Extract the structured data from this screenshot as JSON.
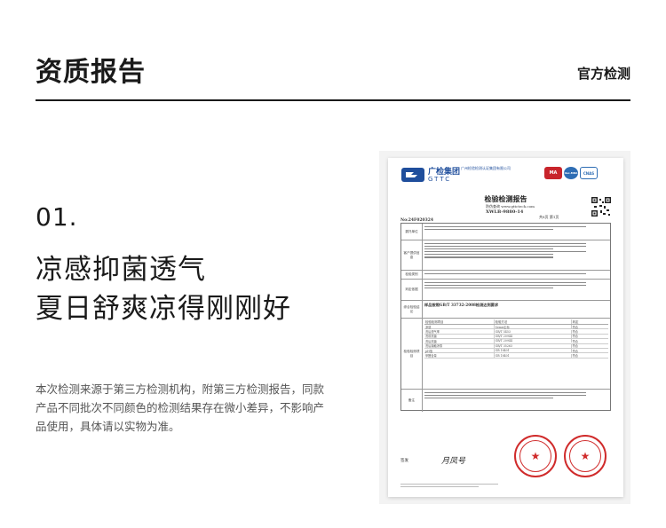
{
  "header": {
    "title": "资质报告",
    "tag": "官方检测"
  },
  "section": {
    "number": "01.",
    "headline_line1": "凉感抑菌透气",
    "headline_line2": "夏日舒爽凉得刚刚好",
    "disclaimer": "本次检测来源于第三方检测机构，附第三方检测报告，同款产品不同批次不同颜色的检测结果存在微小差异，不影响产品使用，具体请以实物为准。"
  },
  "report": {
    "brand_cn": "广检集团",
    "brand_en": "GTTC",
    "org_name": "广州检验检测认证集团有限公司",
    "mark_ma": "MA",
    "mark_ilac": "ilac-MRA",
    "mark_cnas": "CNAS",
    "doc_title": "检验检测报告",
    "report_no_label": "防伪查询 www.gttctech.com",
    "report_code": "XWLB-9880-14",
    "page_info": "共8页 第1页",
    "serial_no": "No:24F020324",
    "rows": {
      "client_label": "委托单位",
      "sample_label": "客户提供信息",
      "receive_label": "检验类别",
      "basis_label": "判定依据",
      "conclusion_label": "综合检验结论",
      "items_label": "检验检测项目",
      "remark_label": "备注"
    },
    "conclusion_text": "样品按照GB/T 33732-2008检测达到要求",
    "sub_headers": [
      "检验检测项目",
      "检验方法",
      "判定"
    ],
    "sub_rows": [
      [
        "凉感",
        "Semir企标",
        "符合"
      ],
      [
        "洗后透气率",
        "GB/T 5453",
        "符合"
      ],
      [
        "洗前抗菌",
        "GB/T 20944",
        "符合"
      ],
      [
        "洗后抗菌",
        "GB/T 20944",
        "符合"
      ],
      [
        "洗后接触凉感",
        "GB/T 35263",
        "符合"
      ],
      [
        "pH值",
        "GB 18401",
        "符合"
      ],
      [
        "甲醛含量",
        "GB 18401",
        "符合"
      ]
    ],
    "signer_label": "签发",
    "signature": "月凤号"
  },
  "colors": {
    "accent_blue": "#1f4e9c",
    "stamp_red": "#d02b2b"
  }
}
